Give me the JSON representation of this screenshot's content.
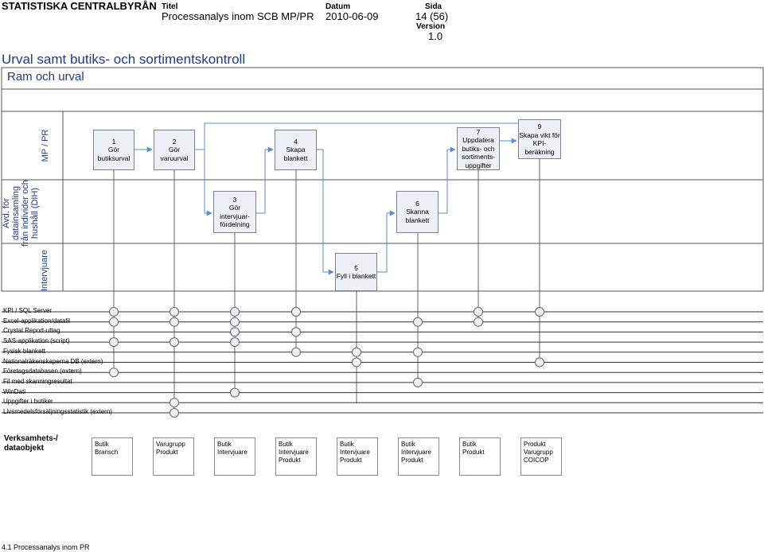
{
  "header": {
    "org": "STATISTISKA CENTRALBYRÅN",
    "title_label": "Titel",
    "title": "Processanalys inom SCB MP/PR",
    "date_label": "Datum",
    "date": "2010-06-09",
    "page_label": "Sida",
    "page": "14 (56)",
    "version_label": "Version",
    "version": "1.0"
  },
  "page_title": "Urval samt butiks- och sortimentskontroll",
  "frame_title": "Ram och urval",
  "lanes": [
    {
      "label": "MP / PR"
    },
    {
      "label": "Avd. för datainsamling från individer och hushåll (DIH)"
    },
    {
      "label": "Intervjuare"
    }
  ],
  "steps": [
    {
      "num": "1",
      "text": "Gör butiksurval"
    },
    {
      "num": "2",
      "text": "Gör varuurval"
    },
    {
      "num": "3",
      "text": "Gör intervjuar-fördelning"
    },
    {
      "num": "4",
      "text": "Skapa blankett"
    },
    {
      "num": "5",
      "text": "Fyll i blankett"
    },
    {
      "num": "6",
      "text": "Skanna blankett"
    },
    {
      "num": "7",
      "text": "Uppdatera butiks- och sortiments-uppgifter"
    },
    {
      "num": "9",
      "text": "Skapa vikt för KPI-beräkning"
    }
  ],
  "systems": [
    "KPI / SQL Server",
    "Excel-applikation/datafil",
    "Crystal Report-uttag",
    "SAS-applikation (script)",
    "Fysisk blankett",
    "Nationalräkenskaperna DB (extern)",
    "Företagsdatabasen (extern)",
    "Fil med skanningresultat",
    "WinDati",
    "Uppgifter i butiker",
    "Livsmedelsförsäljningsstatistik (extern)"
  ],
  "system_usage": [
    [
      0,
      1,
      3,
      6
    ],
    [
      0,
      1,
      3,
      9,
      10
    ],
    [
      0,
      1,
      2,
      3,
      8
    ],
    [
      0,
      2,
      4
    ],
    [
      4,
      5
    ],
    [
      1,
      4,
      7
    ],
    [
      0,
      1
    ],
    [
      0,
      5
    ]
  ],
  "objects_heading": "Verksamhets-/ dataobjekt",
  "objects": [
    "Butik\nBransch",
    "Varugrupp\nProdukt",
    "Butik\nIntervjuare",
    "Butik\nIntervjuare\nProdukt",
    "Butik\nIntervjuare\nProdukt",
    "Butik\nIntervjuare\nProdukt",
    "Butik\nProdukt",
    "Produkt\nVarugrupp\nCOICOP"
  ],
  "footer": "4.1 Processanalys inom PR",
  "colors": {
    "accent": "#1f3a8a",
    "arrow": "#5b8bd0",
    "step_fill": "#eef0f8",
    "node_fill": "#eef0f8"
  }
}
